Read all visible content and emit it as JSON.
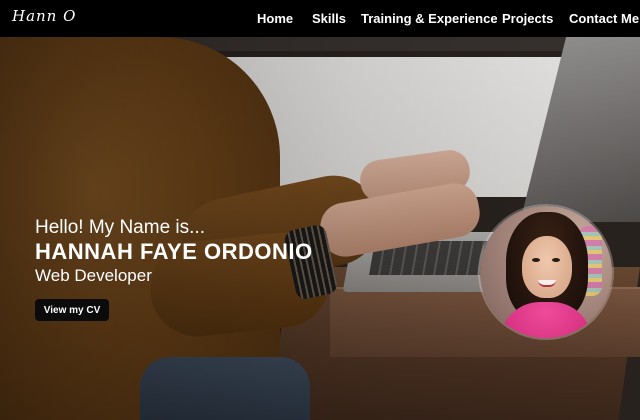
{
  "header": {
    "logo_text": "Hann O",
    "nav": {
      "home": "Home",
      "skills": "Skills",
      "training": "Training & Experience",
      "projects": "Projects",
      "contact": "Contact Me"
    }
  },
  "hero": {
    "greeting": "Hello! My Name is...",
    "name": "HANNAH FAYE ORDONIO",
    "title": "Web Developer",
    "cv_button_label": "View my CV",
    "background_image": "person-typing-on-laptop-photo",
    "avatar_image": "profile-photo"
  },
  "colors": {
    "nav_background": "#000000",
    "text": "#ffffff",
    "button_background": "#0b0b0b"
  }
}
